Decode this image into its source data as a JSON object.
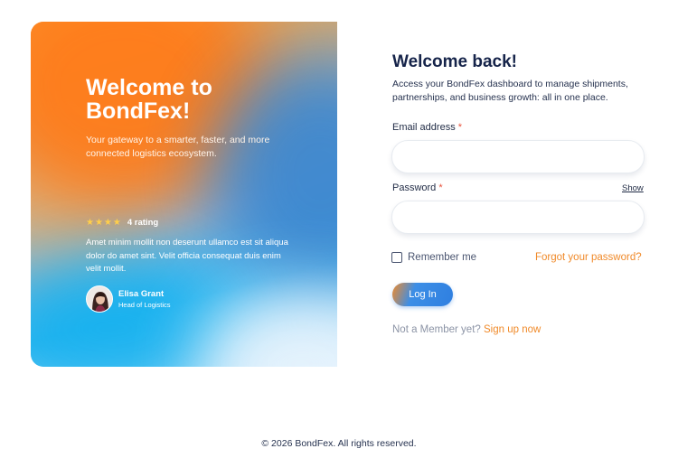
{
  "hero": {
    "title": "Welcome to BondFex!",
    "subtitle": "Your gateway to a smarter, faster, and more connected logistics ecosystem.",
    "rating_stars": "★★★★",
    "rating_label": "4 rating",
    "rating_value": 4,
    "quote": "Amet minim mollit non deserunt ullamco est sit aliqua dolor do amet sint. Velit officia consequat duis enim velit mollit.",
    "author_name": "Elisa Grant",
    "author_role": "Head of Logistics",
    "colors": {
      "orange": "#ff7c1a",
      "blue": "#3a86cf",
      "cyan": "#13b1ef"
    }
  },
  "form": {
    "title": "Welcome back!",
    "subtitle": "Access your BondFex dashboard to manage shipments, partnerships, and business growth: all in one place.",
    "email_label": "Email address",
    "required_mark": "*",
    "email_value": "",
    "password_label": "Password",
    "password_value": "",
    "show_label": "Show",
    "remember_label": "Remember me",
    "remember_checked": false,
    "forgot_label": "Forgot your password?",
    "login_label": "Log In",
    "signup_prompt": "Not a Member yet?",
    "signup_label": "Sign up now",
    "accent_color": "#f08a2a"
  },
  "footer": {
    "text": "© 2026 BondFex. All rights reserved."
  }
}
